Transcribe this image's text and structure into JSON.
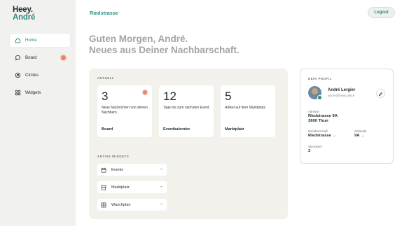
{
  "brand": {
    "line1": "Heey.",
    "line2": "André"
  },
  "sidebar": {
    "items": [
      {
        "label": "Home",
        "icon": "home-icon",
        "active": true
      },
      {
        "label": "Board",
        "icon": "chat-bubble-icon",
        "badge": true
      },
      {
        "label": "Circles",
        "icon": "circles-icon"
      },
      {
        "label": "Widgets",
        "icon": "widgets-icon"
      }
    ]
  },
  "header": {
    "breadcrumb": "Riedstrasse",
    "logout_label": "Logout"
  },
  "greeting": {
    "line1": "Guten Morgen, André.",
    "line2": "Neues aus Deiner Nachbarschaft."
  },
  "current": {
    "label": "AKTUELL",
    "cards": [
      {
        "number": "3",
        "text": "Neue Nachrichten von deinen Nachbarn.",
        "title": "Board"
      },
      {
        "number": "12",
        "text": "Tage bis zum nächsten Event.",
        "title": "Eventkalender"
      },
      {
        "number": "5",
        "text": "Artikel auf dem Marktplatz.",
        "title": "Marktplatz"
      }
    ]
  },
  "widgets": {
    "label": "AKTIVE WIDGETS",
    "items": [
      {
        "label": "Events",
        "icon": "calendar-icon"
      },
      {
        "label": "Marktplatz",
        "icon": "market-icon"
      },
      {
        "label": "Waschplan",
        "icon": "grid-icon"
      }
    ],
    "arrow": "→"
  },
  "profile": {
    "label": "DEIN PROFIL",
    "name": "André Lergier",
    "email": "andre@heey.place",
    "address_label": "Adresse",
    "address_line1": "Riedstrasse 9A",
    "address_line2": "3600 Thun",
    "neighborhood_label": "Nachbarschaft",
    "neighborhood_value": "Riedstrasse",
    "building_label": "Gebäude",
    "building_value": "9A",
    "floor_label": "Stockwerk",
    "floor_value": "3",
    "arrow": "→"
  },
  "colors": {
    "accent": "#2f8a7f",
    "badge": "#e5866a",
    "panel": "#f3f1ec"
  }
}
